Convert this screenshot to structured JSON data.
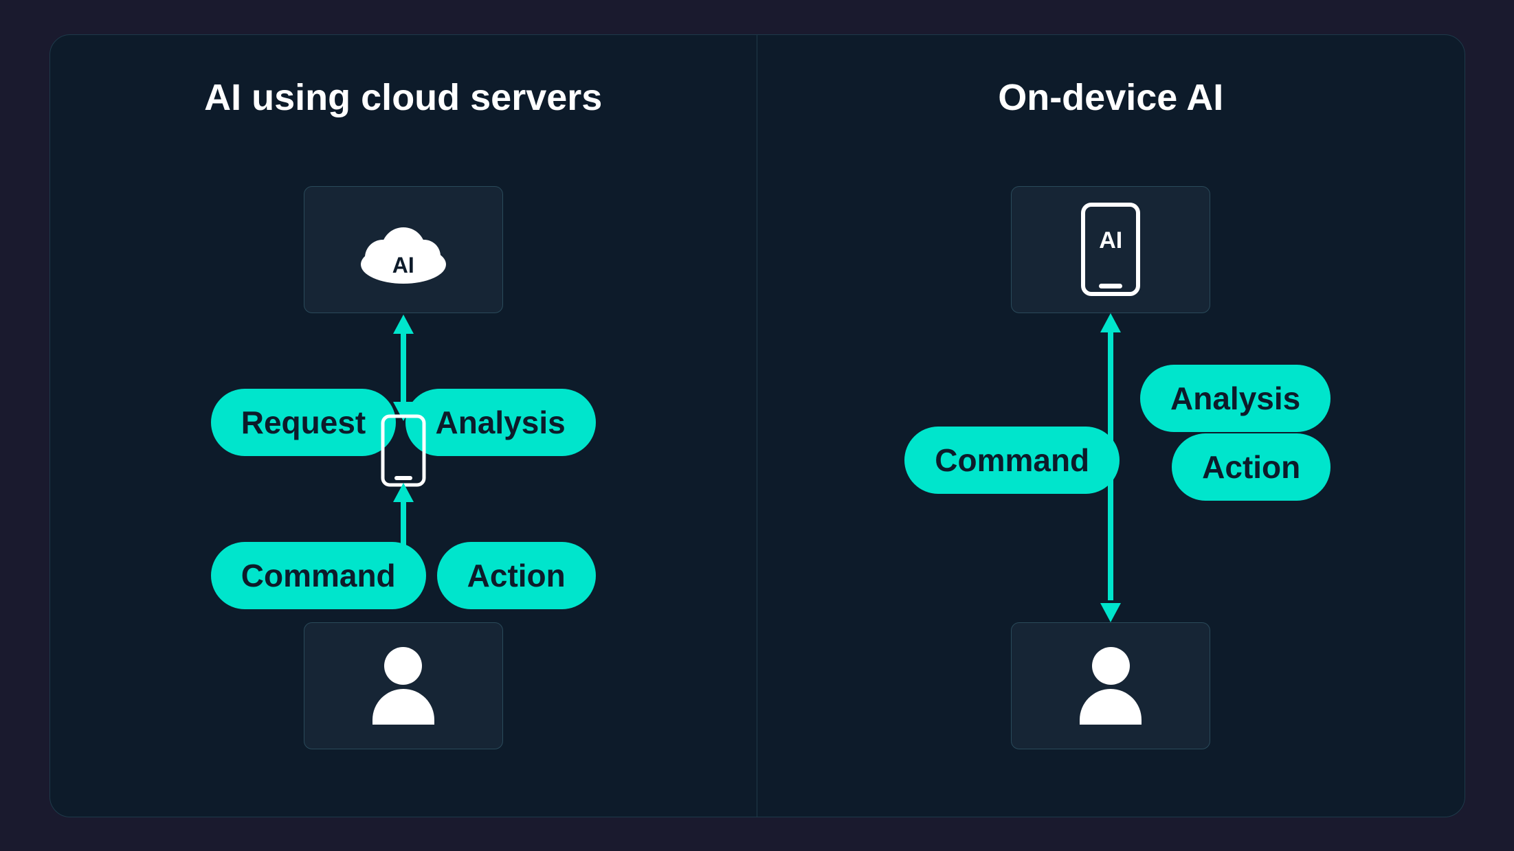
{
  "left_panel": {
    "title": "AI using cloud servers",
    "labels": {
      "request": "Request",
      "analysis": "Analysis",
      "command": "Command",
      "action": "Action"
    },
    "cloud_ai": "AI",
    "colors": {
      "accent": "#00e5cc",
      "bg": "#0d1b2a",
      "box": "#162535"
    }
  },
  "right_panel": {
    "title": "On-device AI",
    "labels": {
      "command": "Command",
      "analysis": "Analysis",
      "action": "Action"
    },
    "phone_ai": "AI"
  }
}
